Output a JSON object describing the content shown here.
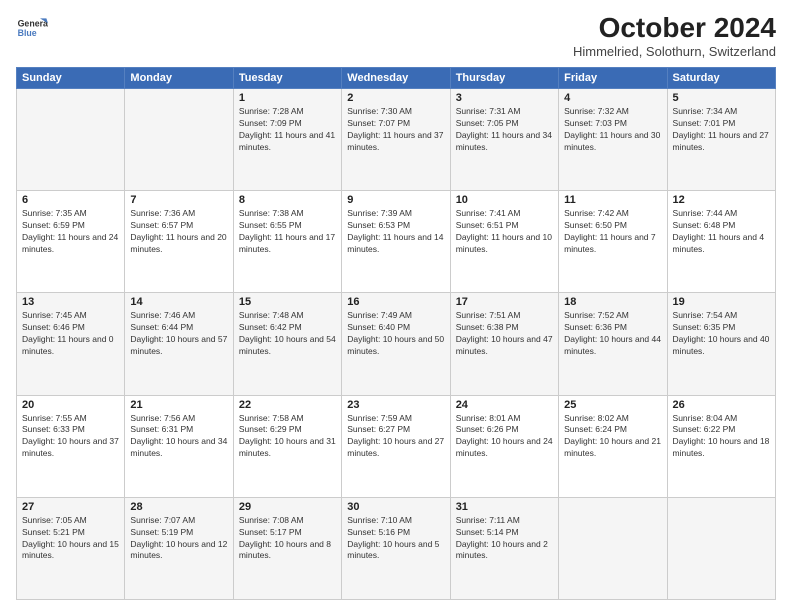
{
  "header": {
    "logo_line1": "General",
    "logo_line2": "Blue",
    "month": "October 2024",
    "location": "Himmelried, Solothurn, Switzerland"
  },
  "weekdays": [
    "Sunday",
    "Monday",
    "Tuesday",
    "Wednesday",
    "Thursday",
    "Friday",
    "Saturday"
  ],
  "weeks": [
    [
      {
        "day": "",
        "sunrise": "",
        "sunset": "",
        "daylight": ""
      },
      {
        "day": "",
        "sunrise": "",
        "sunset": "",
        "daylight": ""
      },
      {
        "day": "1",
        "sunrise": "Sunrise: 7:28 AM",
        "sunset": "Sunset: 7:09 PM",
        "daylight": "Daylight: 11 hours and 41 minutes."
      },
      {
        "day": "2",
        "sunrise": "Sunrise: 7:30 AM",
        "sunset": "Sunset: 7:07 PM",
        "daylight": "Daylight: 11 hours and 37 minutes."
      },
      {
        "day": "3",
        "sunrise": "Sunrise: 7:31 AM",
        "sunset": "Sunset: 7:05 PM",
        "daylight": "Daylight: 11 hours and 34 minutes."
      },
      {
        "day": "4",
        "sunrise": "Sunrise: 7:32 AM",
        "sunset": "Sunset: 7:03 PM",
        "daylight": "Daylight: 11 hours and 30 minutes."
      },
      {
        "day": "5",
        "sunrise": "Sunrise: 7:34 AM",
        "sunset": "Sunset: 7:01 PM",
        "daylight": "Daylight: 11 hours and 27 minutes."
      }
    ],
    [
      {
        "day": "6",
        "sunrise": "Sunrise: 7:35 AM",
        "sunset": "Sunset: 6:59 PM",
        "daylight": "Daylight: 11 hours and 24 minutes."
      },
      {
        "day": "7",
        "sunrise": "Sunrise: 7:36 AM",
        "sunset": "Sunset: 6:57 PM",
        "daylight": "Daylight: 11 hours and 20 minutes."
      },
      {
        "day": "8",
        "sunrise": "Sunrise: 7:38 AM",
        "sunset": "Sunset: 6:55 PM",
        "daylight": "Daylight: 11 hours and 17 minutes."
      },
      {
        "day": "9",
        "sunrise": "Sunrise: 7:39 AM",
        "sunset": "Sunset: 6:53 PM",
        "daylight": "Daylight: 11 hours and 14 minutes."
      },
      {
        "day": "10",
        "sunrise": "Sunrise: 7:41 AM",
        "sunset": "Sunset: 6:51 PM",
        "daylight": "Daylight: 11 hours and 10 minutes."
      },
      {
        "day": "11",
        "sunrise": "Sunrise: 7:42 AM",
        "sunset": "Sunset: 6:50 PM",
        "daylight": "Daylight: 11 hours and 7 minutes."
      },
      {
        "day": "12",
        "sunrise": "Sunrise: 7:44 AM",
        "sunset": "Sunset: 6:48 PM",
        "daylight": "Daylight: 11 hours and 4 minutes."
      }
    ],
    [
      {
        "day": "13",
        "sunrise": "Sunrise: 7:45 AM",
        "sunset": "Sunset: 6:46 PM",
        "daylight": "Daylight: 11 hours and 0 minutes."
      },
      {
        "day": "14",
        "sunrise": "Sunrise: 7:46 AM",
        "sunset": "Sunset: 6:44 PM",
        "daylight": "Daylight: 10 hours and 57 minutes."
      },
      {
        "day": "15",
        "sunrise": "Sunrise: 7:48 AM",
        "sunset": "Sunset: 6:42 PM",
        "daylight": "Daylight: 10 hours and 54 minutes."
      },
      {
        "day": "16",
        "sunrise": "Sunrise: 7:49 AM",
        "sunset": "Sunset: 6:40 PM",
        "daylight": "Daylight: 10 hours and 50 minutes."
      },
      {
        "day": "17",
        "sunrise": "Sunrise: 7:51 AM",
        "sunset": "Sunset: 6:38 PM",
        "daylight": "Daylight: 10 hours and 47 minutes."
      },
      {
        "day": "18",
        "sunrise": "Sunrise: 7:52 AM",
        "sunset": "Sunset: 6:36 PM",
        "daylight": "Daylight: 10 hours and 44 minutes."
      },
      {
        "day": "19",
        "sunrise": "Sunrise: 7:54 AM",
        "sunset": "Sunset: 6:35 PM",
        "daylight": "Daylight: 10 hours and 40 minutes."
      }
    ],
    [
      {
        "day": "20",
        "sunrise": "Sunrise: 7:55 AM",
        "sunset": "Sunset: 6:33 PM",
        "daylight": "Daylight: 10 hours and 37 minutes."
      },
      {
        "day": "21",
        "sunrise": "Sunrise: 7:56 AM",
        "sunset": "Sunset: 6:31 PM",
        "daylight": "Daylight: 10 hours and 34 minutes."
      },
      {
        "day": "22",
        "sunrise": "Sunrise: 7:58 AM",
        "sunset": "Sunset: 6:29 PM",
        "daylight": "Daylight: 10 hours and 31 minutes."
      },
      {
        "day": "23",
        "sunrise": "Sunrise: 7:59 AM",
        "sunset": "Sunset: 6:27 PM",
        "daylight": "Daylight: 10 hours and 27 minutes."
      },
      {
        "day": "24",
        "sunrise": "Sunrise: 8:01 AM",
        "sunset": "Sunset: 6:26 PM",
        "daylight": "Daylight: 10 hours and 24 minutes."
      },
      {
        "day": "25",
        "sunrise": "Sunrise: 8:02 AM",
        "sunset": "Sunset: 6:24 PM",
        "daylight": "Daylight: 10 hours and 21 minutes."
      },
      {
        "day": "26",
        "sunrise": "Sunrise: 8:04 AM",
        "sunset": "Sunset: 6:22 PM",
        "daylight": "Daylight: 10 hours and 18 minutes."
      }
    ],
    [
      {
        "day": "27",
        "sunrise": "Sunrise: 7:05 AM",
        "sunset": "Sunset: 5:21 PM",
        "daylight": "Daylight: 10 hours and 15 minutes."
      },
      {
        "day": "28",
        "sunrise": "Sunrise: 7:07 AM",
        "sunset": "Sunset: 5:19 PM",
        "daylight": "Daylight: 10 hours and 12 minutes."
      },
      {
        "day": "29",
        "sunrise": "Sunrise: 7:08 AM",
        "sunset": "Sunset: 5:17 PM",
        "daylight": "Daylight: 10 hours and 8 minutes."
      },
      {
        "day": "30",
        "sunrise": "Sunrise: 7:10 AM",
        "sunset": "Sunset: 5:16 PM",
        "daylight": "Daylight: 10 hours and 5 minutes."
      },
      {
        "day": "31",
        "sunrise": "Sunrise: 7:11 AM",
        "sunset": "Sunset: 5:14 PM",
        "daylight": "Daylight: 10 hours and 2 minutes."
      },
      {
        "day": "",
        "sunrise": "",
        "sunset": "",
        "daylight": ""
      },
      {
        "day": "",
        "sunrise": "",
        "sunset": "",
        "daylight": ""
      }
    ]
  ]
}
